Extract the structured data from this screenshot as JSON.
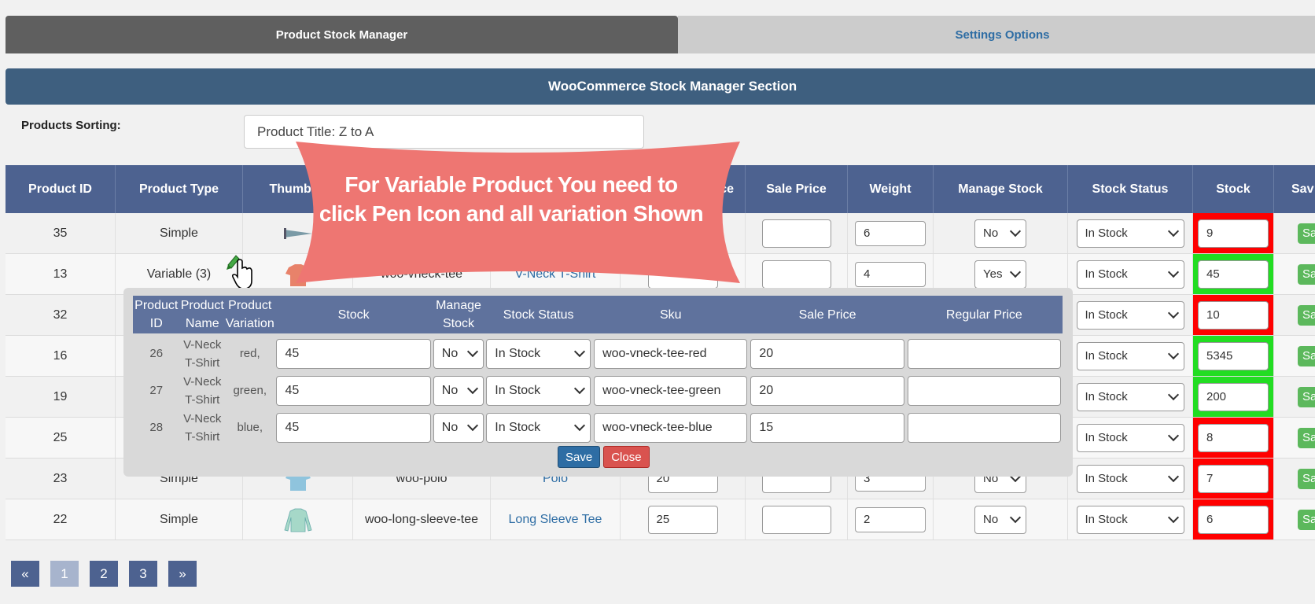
{
  "tabs": {
    "active": "Product Stock Manager",
    "inactive": "Settings Options"
  },
  "section_title": "WooCommerce Stock Manager Section",
  "sorting": {
    "label": "Products Sorting:",
    "value": "Product Title: Z to A"
  },
  "table": {
    "headers": {
      "id": "Product ID",
      "type": "Product Type",
      "thumb": "Thumbna",
      "reg": "ce",
      "sale": "Sale Price",
      "weight": "Weight",
      "manage": "Manage Stock",
      "status": "Stock Status",
      "stock": "Stock",
      "save": "Sav"
    },
    "save_label": "Sav",
    "rows": [
      {
        "id": "35",
        "type": "Simple",
        "sku": "",
        "name": "",
        "reg": "",
        "sale": "",
        "weight": "6",
        "manage": "No",
        "status": "In Stock",
        "stock": "9",
        "stock_color": "red"
      },
      {
        "id": "13",
        "type": "Variable (3)",
        "sku": "woo-vneck-tee",
        "name": "V-Neck T-Shirt",
        "reg": "",
        "sale": "",
        "weight": "4",
        "manage": "Yes",
        "status": "In Stock",
        "stock": "45",
        "stock_color": "green"
      },
      {
        "id": "32",
        "type": "",
        "sku": "",
        "name": "",
        "reg": "",
        "sale": "",
        "weight": "",
        "manage": "",
        "status": "In Stock",
        "stock": "10",
        "stock_color": "red"
      },
      {
        "id": "16",
        "type": "",
        "sku": "",
        "name": "",
        "reg": "",
        "sale": "",
        "weight": "",
        "manage": "",
        "status": "In Stock",
        "stock": "5345",
        "stock_color": "green"
      },
      {
        "id": "19",
        "type": "",
        "sku": "",
        "name": "",
        "reg": "",
        "sale": "",
        "weight": "",
        "manage": "",
        "status": "In Stock",
        "stock": "200",
        "stock_color": "green"
      },
      {
        "id": "25",
        "type": "",
        "sku": "",
        "name": "",
        "reg": "",
        "sale": "",
        "weight": "",
        "manage": "",
        "status": "In Stock",
        "stock": "8",
        "stock_color": "red"
      },
      {
        "id": "23",
        "type": "Simple",
        "sku": "woo-polo",
        "name": "Polo",
        "reg": "20",
        "sale": "",
        "weight": "3",
        "manage": "No",
        "status": "In Stock",
        "stock": "7",
        "stock_color": "red"
      },
      {
        "id": "22",
        "type": "Simple",
        "sku": "woo-long-sleeve-tee",
        "name": "Long Sleeve Tee",
        "reg": "25",
        "sale": "",
        "weight": "2",
        "manage": "No",
        "status": "In Stock",
        "stock": "6",
        "stock_color": "red"
      }
    ]
  },
  "popup": {
    "headers": {
      "id": "Product ID",
      "name": "Product Name",
      "variation": "Product Variation",
      "stock": "Stock",
      "manage": "Manage Stock",
      "status": "Stock Status",
      "sku": "Sku",
      "sale": "Sale Price",
      "reg": "Regular Price"
    },
    "rows": [
      {
        "id": "26",
        "name": "V-Neck T-Shirt",
        "variation": "red,",
        "stock": "45",
        "manage": "No",
        "status": "In Stock",
        "sku": "woo-vneck-tee-red",
        "sale": "20",
        "reg": ""
      },
      {
        "id": "27",
        "name": "V-Neck T-Shirt",
        "variation": "green,",
        "stock": "45",
        "manage": "No",
        "status": "In Stock",
        "sku": "woo-vneck-tee-green",
        "sale": "20",
        "reg": ""
      },
      {
        "id": "28",
        "name": "V-Neck T-Shirt",
        "variation": "blue,",
        "stock": "45",
        "manage": "No",
        "status": "In Stock",
        "sku": "woo-vneck-tee-blue",
        "sale": "15",
        "reg": ""
      }
    ],
    "save_label": "Save",
    "close_label": "Close"
  },
  "callout": {
    "text": "For Variable Product You need to click Pen Icon and all variation Shown",
    "color": "#ee7672"
  },
  "pagination": {
    "prev": "«",
    "pages": [
      "1",
      "2",
      "3"
    ],
    "current": "1",
    "next": "»"
  }
}
